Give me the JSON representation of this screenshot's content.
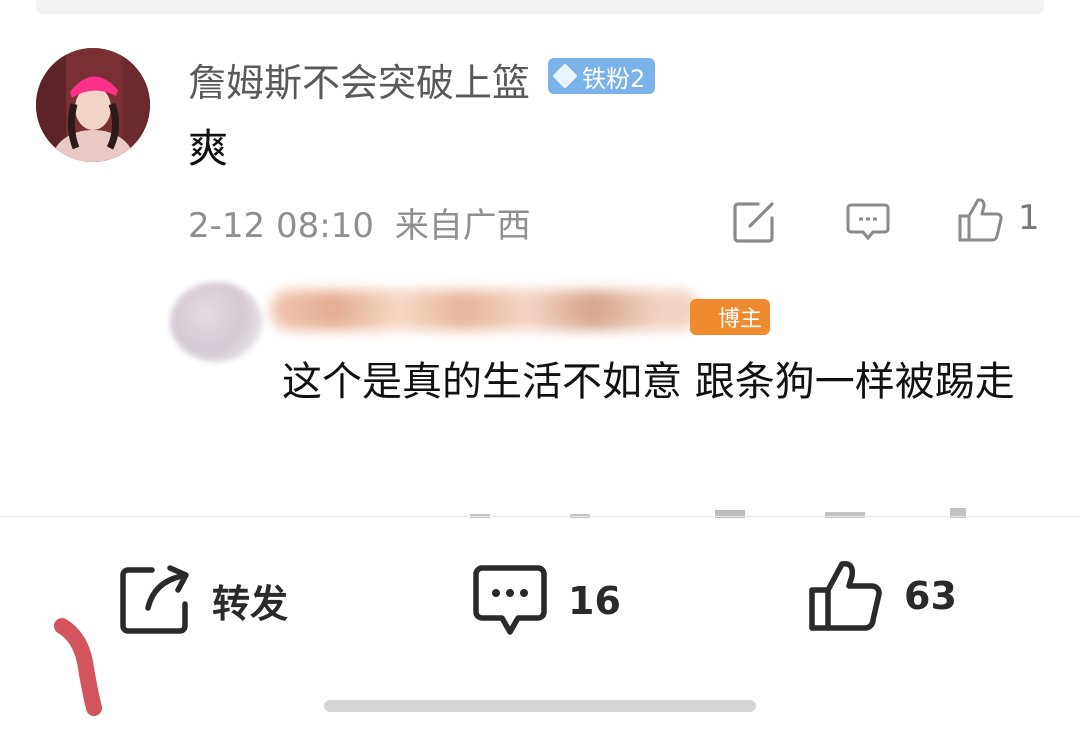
{
  "comment": {
    "username": "詹姆斯不会突破上篮",
    "fan_badge": "铁粉2",
    "text": "爽",
    "timestamp": "2-12 08:10",
    "location": "来自广西",
    "like_count": "1"
  },
  "reply": {
    "author_badge": "博主",
    "text": "这个是真的生活不如意 跟条狗一样被踢走"
  },
  "bottom_bar": {
    "repost_label": "转发",
    "comment_count": "16",
    "like_count": "63"
  },
  "colors": {
    "fan_badge": "#7ab2ea",
    "author_badge": "#f08a2e",
    "meta_text": "#8f8f8f",
    "annotation": "#d2545c"
  },
  "icons": [
    "diamond-icon",
    "edit-icon",
    "comment-icon",
    "thumbs-up-icon",
    "share-icon"
  ]
}
